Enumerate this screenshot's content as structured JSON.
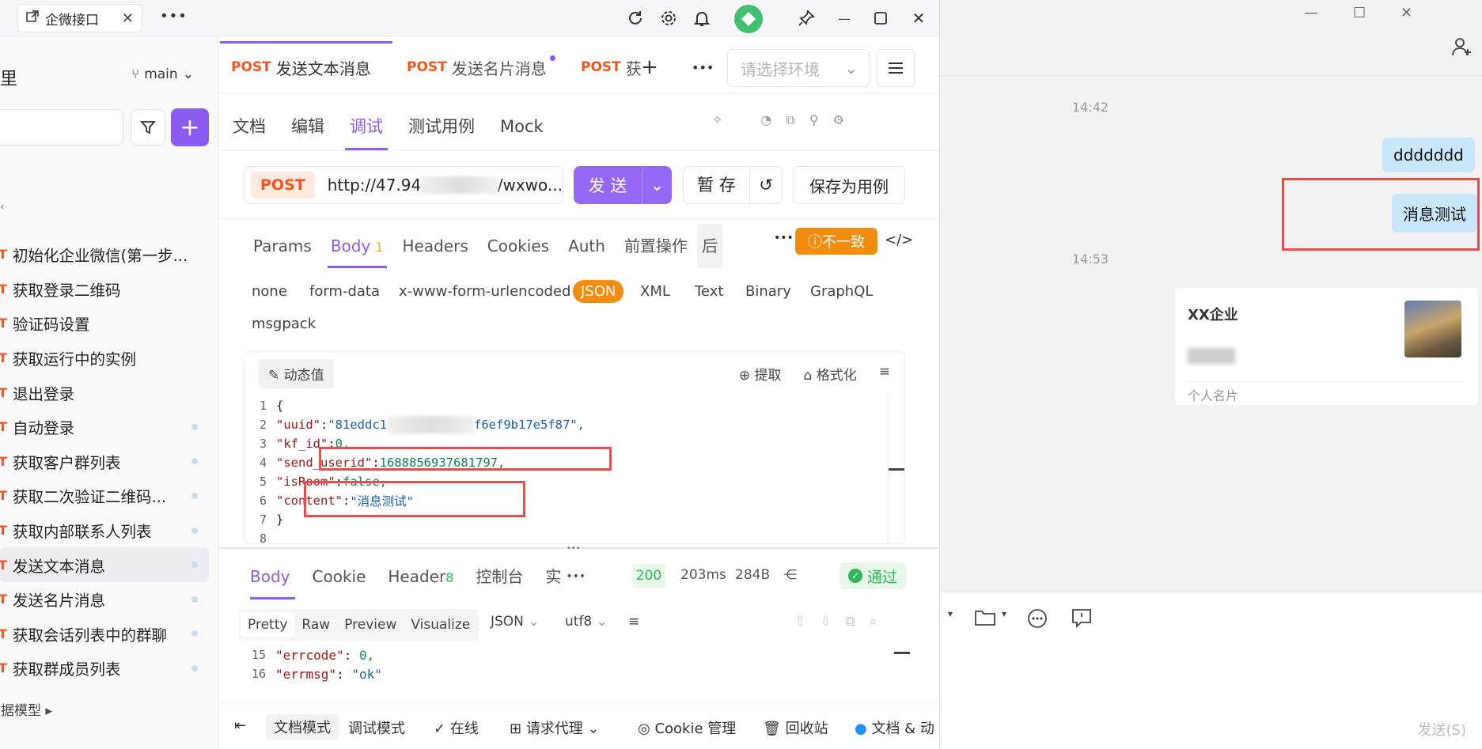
{
  "titlebar": {
    "tab_label": "企微接口"
  },
  "sidebar": {
    "title": "里",
    "branch": "main",
    "items": [
      {
        "method": "T",
        "label": "初始化企业微信(第一步...",
        "dot": false
      },
      {
        "method": "T",
        "label": "获取登录二维码",
        "dot": false
      },
      {
        "method": "T",
        "label": "验证码设置",
        "dot": false
      },
      {
        "method": "T",
        "label": "获取运行中的实例",
        "dot": false
      },
      {
        "method": "T",
        "label": "退出登录",
        "dot": false
      },
      {
        "method": "T",
        "label": "自动登录",
        "dot": true
      },
      {
        "method": "T",
        "label": "获取客户群列表",
        "dot": true
      },
      {
        "method": "T",
        "label": "获取二次验证二维码...",
        "dot": true
      },
      {
        "method": "T",
        "label": "获取内部联系人列表",
        "dot": true
      },
      {
        "method": "T",
        "label": "发送文本消息",
        "dot": true,
        "active": true
      },
      {
        "method": "T",
        "label": "发送名片消息",
        "dot": true
      },
      {
        "method": "T",
        "label": "获取会话列表中的群聊",
        "dot": true
      },
      {
        "method": "T",
        "label": "获取群成员列表",
        "dot": true
      }
    ],
    "bottom_label": "数据模型"
  },
  "tabs": [
    {
      "method": "POST",
      "label": "发送文本消息"
    },
    {
      "method": "POST",
      "label": "发送名片消息"
    },
    {
      "method": "POST",
      "label": "获"
    }
  ],
  "env_placeholder": "请选择环境",
  "subtabs": [
    "文档",
    "编辑",
    "调试",
    "测试用例",
    "Mock"
  ],
  "request": {
    "method": "POST",
    "url_start": "http://47.94",
    "url_end": "/wxwo...",
    "send": "发 送",
    "save_tmp": "暂 存",
    "save_case": "保存为用例"
  },
  "param_tabs": [
    "Params",
    "Body",
    "Headers",
    "Cookies",
    "Auth",
    "前置操作",
    "后"
  ],
  "body_count": "1",
  "mismatch": "不一致",
  "body_types": [
    "none",
    "form-data",
    "x-www-form-urlencoded",
    "JSON",
    "XML",
    "Text",
    "Binary",
    "GraphQL",
    "msgpack"
  ],
  "editor": {
    "dynamic": "动态值",
    "extract": "提取",
    "format": "格式化"
  },
  "code": {
    "l1": "{",
    "uuid_key": "\"uuid\"",
    "uuid_val": "\"81eddc1",
    "uuid_tail": "f6ef9b17e5f87\",",
    "kf_key": "\"kf_id\"",
    "kf_val": "0,",
    "su_key": "\"send_userid\"",
    "su_val": "1688856937681797,",
    "ir_key": "\"isRoom\"",
    "ir_val": "false,",
    "ct_key": "\"content\"",
    "ct_val": "\"消息测试\"",
    "l7": "}"
  },
  "line_numbers": [
    "1",
    "2",
    "3",
    "4",
    "5",
    "6",
    "7",
    "8"
  ],
  "response": {
    "tabs": [
      "Body",
      "Cookie",
      "Header",
      "控制台",
      "实"
    ],
    "header_count": "8",
    "status": "200",
    "time": "203ms",
    "size": "284B",
    "pass": "通过",
    "views": [
      "Pretty",
      "Raw",
      "Preview",
      "Visualize"
    ],
    "format": "JSON",
    "encoding": "utf8",
    "lines": [
      {
        "n": "15",
        "k": "\"errcode\"",
        "v": "0,"
      },
      {
        "n": "16",
        "k": "\"errmsg\"",
        "v": "\"ok\""
      }
    ]
  },
  "bottombar": {
    "doc_mode": "文档模式",
    "debug_mode": "调试模式",
    "online": "在线",
    "proxy": "请求代理",
    "cookie": "Cookie 管理",
    "trash": "回收站",
    "docs": "文档 & 动"
  },
  "chat": {
    "time1": "14:42",
    "msg1": "ddddddd",
    "msg2": "消息测试",
    "time2": "14:53",
    "card_title": "XX企业",
    "card_footer": "个人名片",
    "send": "发送(S)"
  },
  "colors": {
    "accent": "#8c5bf2",
    "post": "#f5541f",
    "highlight": "#ea4b4b",
    "bubble": "#c9e7fb"
  }
}
